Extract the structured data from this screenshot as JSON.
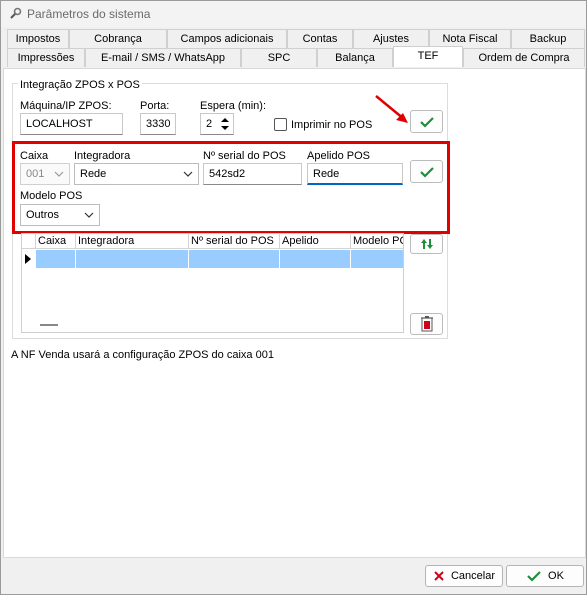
{
  "window": {
    "title": "Parâmetros do sistema"
  },
  "tabs": {
    "row1": [
      "Impostos",
      "Cobrança",
      "Campos adicionais",
      "Contas",
      "Ajustes",
      "Nota Fiscal",
      "Backup"
    ],
    "row2": [
      "Impressões",
      "E-mail / SMS / WhatsApp",
      "SPC",
      "Balança",
      "TEF",
      "Ordem de Compra"
    ],
    "active": "TEF"
  },
  "group": {
    "title": "Integração ZPOS x POS",
    "maquina_label": "Máquina/IP ZPOS:",
    "maquina_value": "LOCALHOST",
    "porta_label": "Porta:",
    "porta_value": "3330",
    "espera_label": "Espera (min):",
    "espera_value": "2",
    "imprimir_label": "Imprimir no POS",
    "imprimir_checked": false
  },
  "pos_form": {
    "caixa_label": "Caixa",
    "caixa_value": "001",
    "integradora_label": "Integradora",
    "integradora_value": "Rede",
    "serial_label": "Nº serial do POS",
    "serial_value": "542sd2",
    "apelido_label": "Apelido POS",
    "apelido_value": "Rede",
    "modelo_label": "Modelo POS",
    "modelo_value": "Outros"
  },
  "grid": {
    "columns": [
      "Caixa",
      "Integradora",
      "Nº serial do POS",
      "Apelido",
      "Modelo PC"
    ],
    "rows": [
      [
        "",
        "",
        "",
        "",
        ""
      ]
    ]
  },
  "info_text": "A NF Venda usará a configuração ZPOS do caixa 001",
  "footer": {
    "cancel_label": "Cancelar",
    "ok_label": "OK"
  },
  "colors": {
    "accent": "#0067c0",
    "highlight": "#e00000",
    "selected_row": "#99ccff",
    "ok_green": "#1e8e3e",
    "cancel_red": "#d0021b"
  }
}
